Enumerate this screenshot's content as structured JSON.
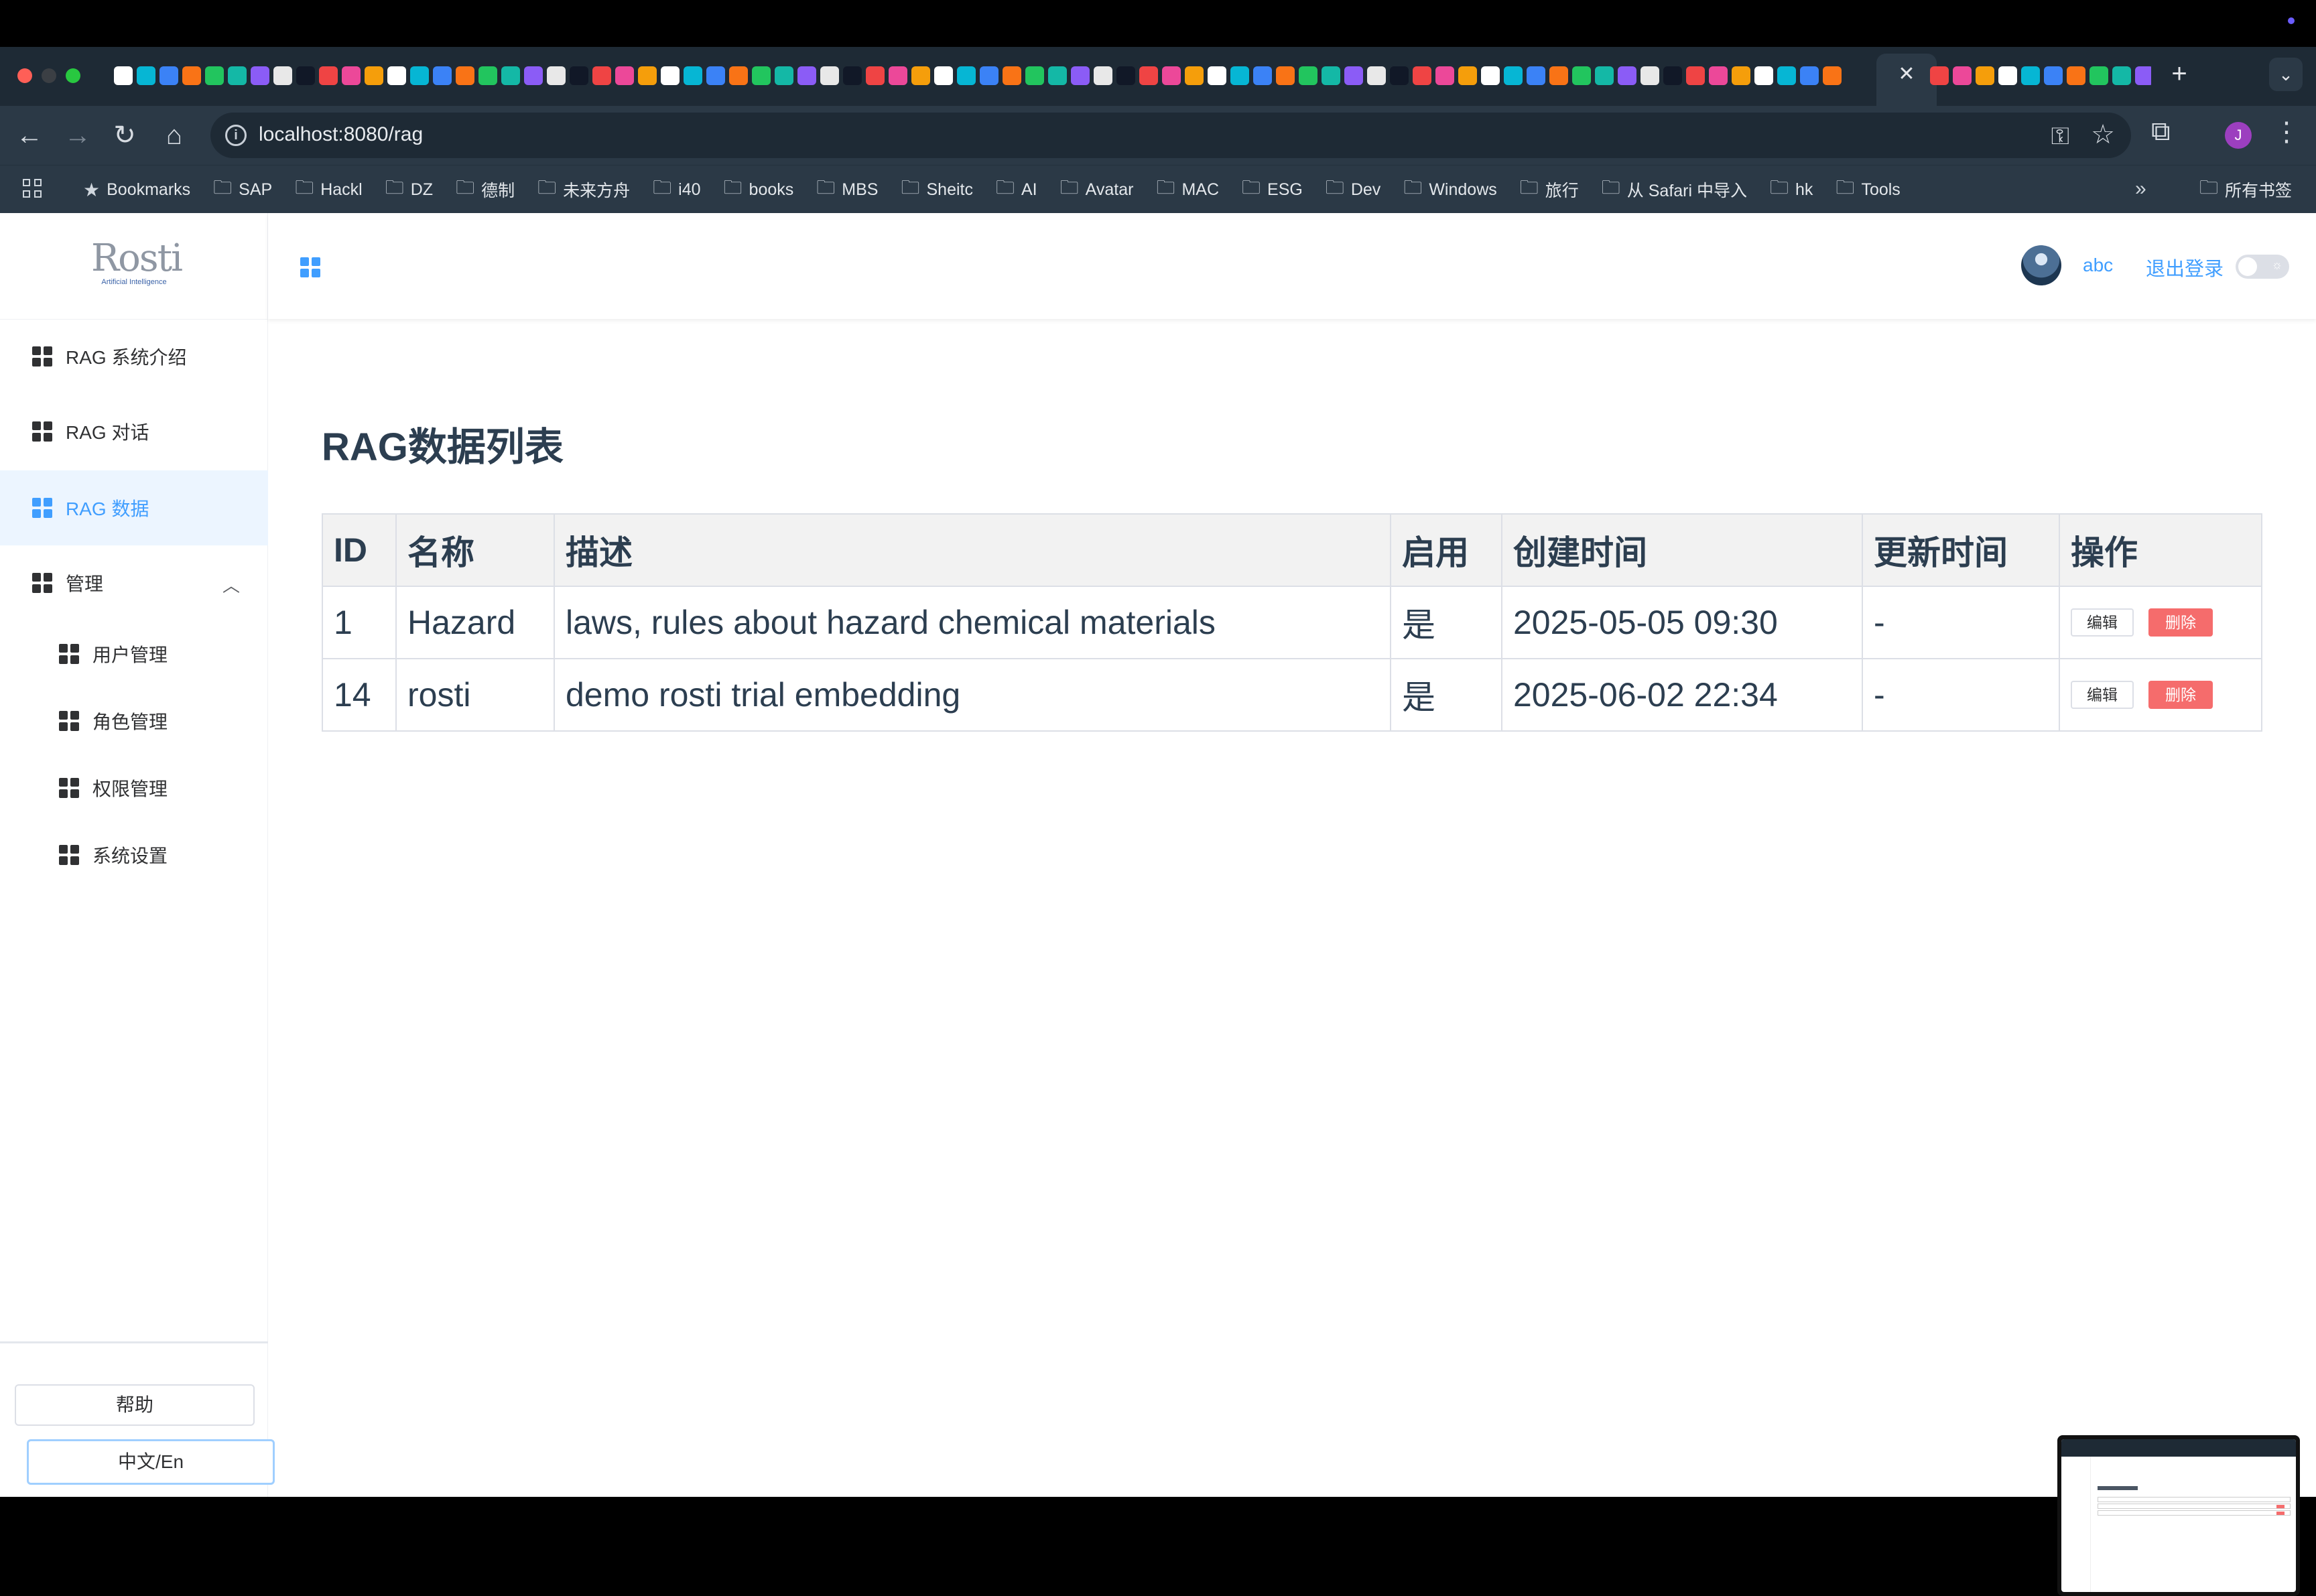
{
  "browser": {
    "url": "localhost:8080/rag",
    "profile_initial": "J",
    "tab_close_glyph": "✕",
    "new_tab_glyph": "+",
    "bookmarks": [
      "Bookmarks",
      "SAP",
      "Hackl",
      "DZ",
      "德制",
      "未来方舟",
      "i40",
      "books",
      "MBS",
      "Sheitc",
      "AI",
      "Avatar",
      "MAC",
      "ESG",
      "Dev",
      "Windows",
      "旅行",
      "从 Safari 中导入",
      "hk",
      "Tools"
    ],
    "all_bookmarks": "所有书签"
  },
  "logo": {
    "main": "Rosti",
    "sub": "Artificial Intelligence"
  },
  "sidebar": {
    "items": [
      {
        "label": "RAG 系统介绍",
        "icon": "grid-icon"
      },
      {
        "label": "RAG 对话",
        "icon": "grid-icon"
      },
      {
        "label": "RAG 数据",
        "icon": "grid-icon",
        "active": true
      },
      {
        "label": "管理",
        "icon": "grid-icon",
        "expanded": true
      }
    ],
    "sub_items": [
      {
        "label": "用户管理"
      },
      {
        "label": "角色管理"
      },
      {
        "label": "权限管理"
      },
      {
        "label": "系统设置"
      }
    ],
    "help_label": "帮助",
    "lang_label": "中文/En"
  },
  "header": {
    "user_name": "abc",
    "logout_label": "退出登录"
  },
  "main": {
    "title": "RAG数据列表",
    "table": {
      "headers": [
        "ID",
        "名称",
        "描述",
        "启用",
        "创建时间",
        "更新时间",
        "操作"
      ],
      "rows": [
        {
          "id": "1",
          "name": "Hazard",
          "description": "laws, rules about hazard chemical materials",
          "enabled": "是",
          "created": "2025-05-05 09:30",
          "updated": "-"
        },
        {
          "id": "14",
          "name": "rosti",
          "description": "demo rosti trial embedding",
          "enabled": "是",
          "created": "2025-06-02 22:34",
          "updated": "-"
        }
      ],
      "edit_label": "编辑",
      "delete_label": "删除"
    }
  },
  "colors": {
    "accent": "#409eff",
    "danger": "#f56c6c",
    "active_bg": "#ecf5ff",
    "chrome_bg": "#2b3946",
    "title_text": "#2c3e50"
  }
}
